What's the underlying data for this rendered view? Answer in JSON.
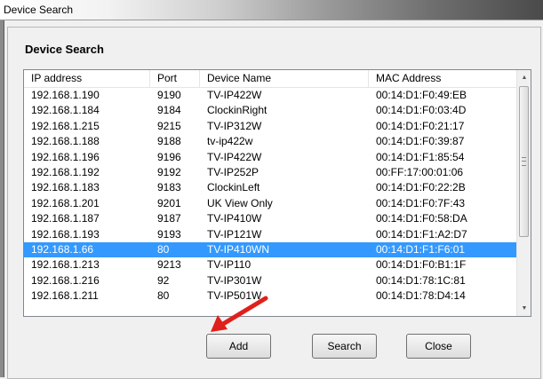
{
  "window": {
    "title": "Device Search"
  },
  "dialog": {
    "heading": "Device Search"
  },
  "table": {
    "columns": [
      "IP address",
      "Port",
      "Device Name",
      "MAC Address"
    ],
    "rows": [
      [
        "192.168.1.190",
        "9190",
        "TV-IP422W",
        "00:14:D1:F0:49:EB"
      ],
      [
        "192.168.1.184",
        "9184",
        "ClockinRight",
        "00:14:D1:F0:03:4D"
      ],
      [
        "192.168.1.215",
        "9215",
        "TV-IP312W",
        "00:14:D1:F0:21:17"
      ],
      [
        "192.168.1.188",
        "9188",
        "tv-ip422w",
        "00:14:D1:F0:39:87"
      ],
      [
        "192.168.1.196",
        "9196",
        "TV-IP422W",
        "00:14:D1:F1:85:54"
      ],
      [
        "192.168.1.192",
        "9192",
        "TV-IP252P",
        "00:FF:17:00:01:06"
      ],
      [
        "192.168.1.183",
        "9183",
        "ClockinLeft",
        "00:14:D1:F0:22:2B"
      ],
      [
        "192.168.1.201",
        "9201",
        "UK View Only",
        "00:14:D1:F0:7F:43"
      ],
      [
        "192.168.1.187",
        "9187",
        "TV-IP410W",
        "00:14:D1:F0:58:DA"
      ],
      [
        "192.168.1.193",
        "9193",
        "TV-IP121W",
        "00:14:D1:F1:A2:D7"
      ],
      [
        "192.168.1.66",
        "80",
        "TV-IP410WN",
        "00:14:D1:F1:F6:01"
      ],
      [
        "192.168.1.213",
        "9213",
        "TV-IP110",
        "00:14:D1:F0:B1:1F"
      ],
      [
        "192.168.1.216",
        "92",
        "TV-IP301W",
        "00:14:D1:78:1C:81"
      ],
      [
        "192.168.1.211",
        "80",
        "TV-IP501W",
        "00:14:D1:78:D4:14"
      ]
    ],
    "selected_index": 10
  },
  "buttons": {
    "add": "Add",
    "search": "Search",
    "close": "Close"
  },
  "colors": {
    "selection": "#3399ff",
    "arrow": "#e0201b"
  }
}
